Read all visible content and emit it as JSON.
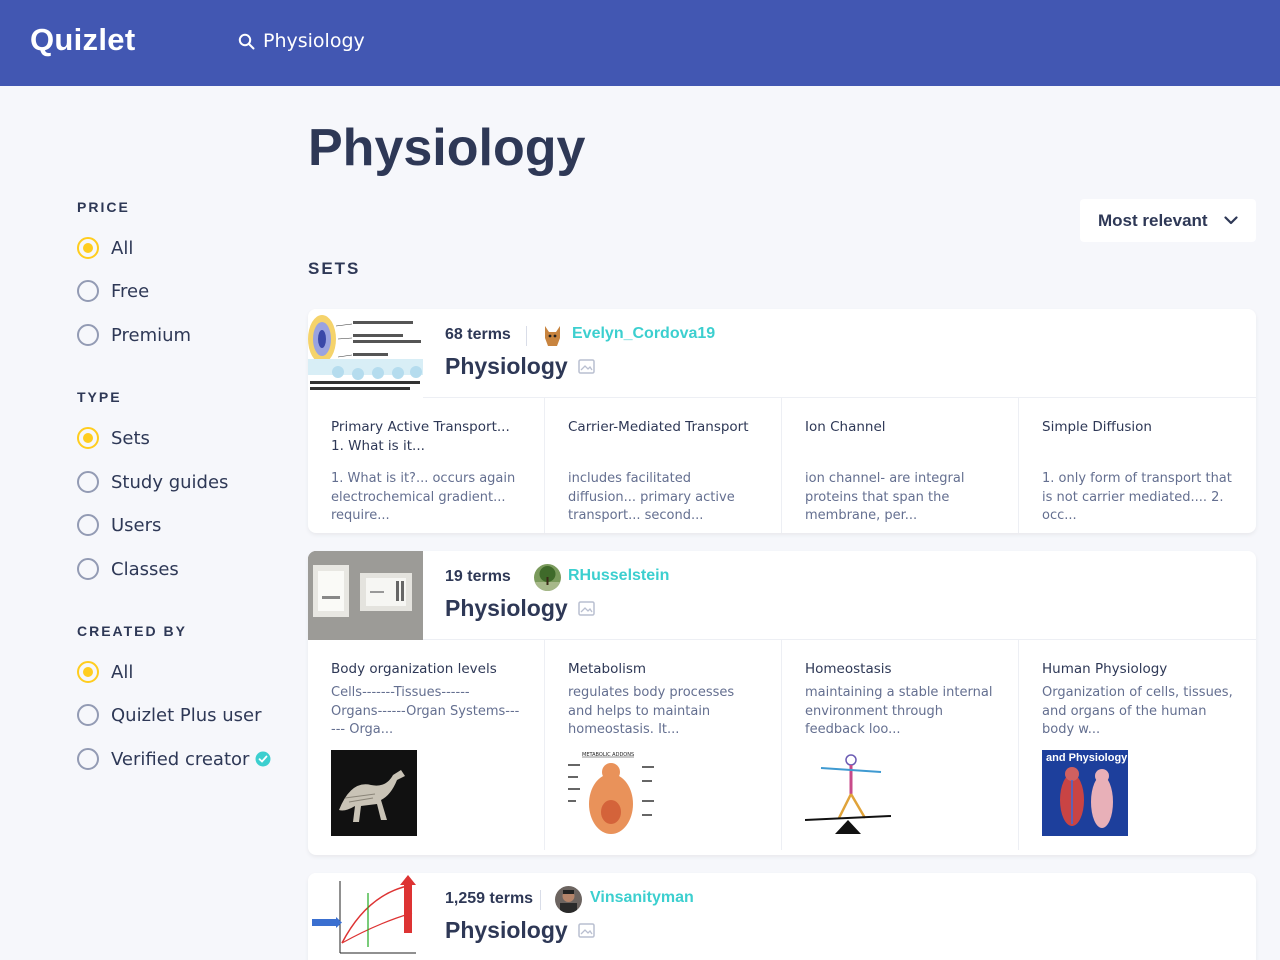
{
  "header": {
    "logo": "Quizlet",
    "search_value": "Physiology"
  },
  "page_title": "Physiology",
  "sort": {
    "selected": "Most relevant"
  },
  "section_label": "SETS",
  "filters": {
    "price": {
      "heading": "PRICE",
      "options": [
        "All",
        "Free",
        "Premium"
      ],
      "selected": "All"
    },
    "type": {
      "heading": "TYPE",
      "options": [
        "Sets",
        "Study guides",
        "Users",
        "Classes"
      ],
      "selected": "Sets"
    },
    "created_by": {
      "heading": "CREATED BY",
      "options": [
        "All",
        "Quizlet Plus user",
        "Verified creator"
      ],
      "selected": "All"
    }
  },
  "colors": {
    "brand": "#4257b2",
    "accent": "#ffcd1f",
    "link": "#3ccfcf"
  },
  "sets": [
    {
      "terms": "68 terms",
      "user": "Evelyn_Cordova19",
      "title": "Physiology",
      "cards": [
        {
          "term": "Primary Active Transport... 1. What is it...",
          "definition": "1. What is it?... occurs again electrochemical gradient... require..."
        },
        {
          "term": "Carrier-Mediated Transport",
          "definition": "includes facilitated diffusion... primary active transport... second..."
        },
        {
          "term": "Ion Channel",
          "definition": "ion channel- are integral proteins that span the membrane, per..."
        },
        {
          "term": "Simple Diffusion",
          "definition": "1. only form of transport that is not carrier mediated.... 2. occ..."
        }
      ]
    },
    {
      "terms": "19 terms",
      "user": "RHusselstein",
      "title": "Physiology",
      "cards": [
        {
          "term": "Body organization levels",
          "definition": "Cells-------Tissues------ Organs------Organ Systems------ Orga..."
        },
        {
          "term": "Metabolism",
          "definition": "regulates body processes and helps to maintain homeostasis. It..."
        },
        {
          "term": "Homeostasis",
          "definition": "maintaining a stable internal environment through feedback loo..."
        },
        {
          "term": "Human Physiology",
          "definition": "Organization of cells, tissues, and organs of the human body w..."
        }
      ]
    },
    {
      "terms": "1,259 terms",
      "user": "Vinsanityman",
      "title": "Physiology"
    }
  ],
  "image_text": {
    "book_cover": "and Physiology",
    "metabolism_chart": "METABOLIC ADDONS"
  }
}
